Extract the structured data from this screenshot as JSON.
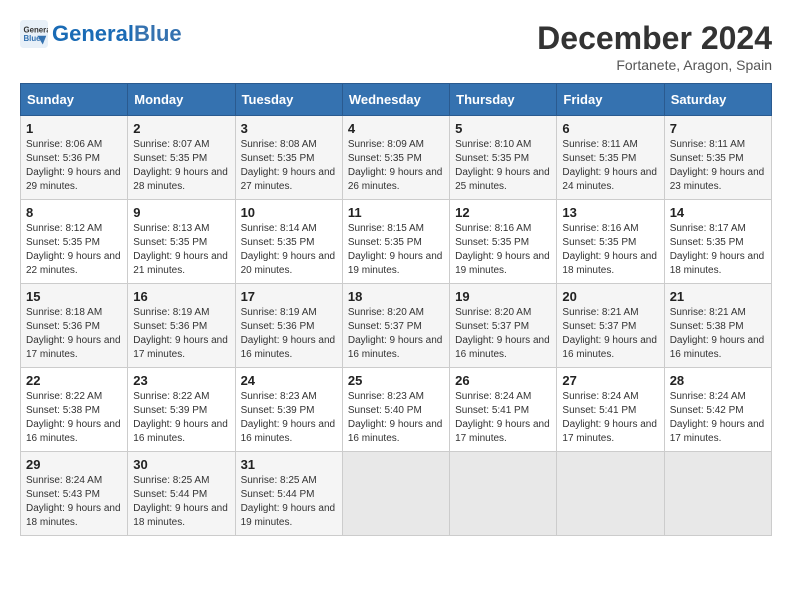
{
  "logo": {
    "text_general": "General",
    "text_blue": "Blue"
  },
  "title": "December 2024",
  "subtitle": "Fortanete, Aragon, Spain",
  "days_header": [
    "Sunday",
    "Monday",
    "Tuesday",
    "Wednesday",
    "Thursday",
    "Friday",
    "Saturday"
  ],
  "weeks": [
    [
      {
        "day": "1",
        "sunrise": "Sunrise: 8:06 AM",
        "sunset": "Sunset: 5:36 PM",
        "daylight": "Daylight: 9 hours and 29 minutes."
      },
      {
        "day": "2",
        "sunrise": "Sunrise: 8:07 AM",
        "sunset": "Sunset: 5:35 PM",
        "daylight": "Daylight: 9 hours and 28 minutes."
      },
      {
        "day": "3",
        "sunrise": "Sunrise: 8:08 AM",
        "sunset": "Sunset: 5:35 PM",
        "daylight": "Daylight: 9 hours and 27 minutes."
      },
      {
        "day": "4",
        "sunrise": "Sunrise: 8:09 AM",
        "sunset": "Sunset: 5:35 PM",
        "daylight": "Daylight: 9 hours and 26 minutes."
      },
      {
        "day": "5",
        "sunrise": "Sunrise: 8:10 AM",
        "sunset": "Sunset: 5:35 PM",
        "daylight": "Daylight: 9 hours and 25 minutes."
      },
      {
        "day": "6",
        "sunrise": "Sunrise: 8:11 AM",
        "sunset": "Sunset: 5:35 PM",
        "daylight": "Daylight: 9 hours and 24 minutes."
      },
      {
        "day": "7",
        "sunrise": "Sunrise: 8:11 AM",
        "sunset": "Sunset: 5:35 PM",
        "daylight": "Daylight: 9 hours and 23 minutes."
      }
    ],
    [
      {
        "day": "8",
        "sunrise": "Sunrise: 8:12 AM",
        "sunset": "Sunset: 5:35 PM",
        "daylight": "Daylight: 9 hours and 22 minutes."
      },
      {
        "day": "9",
        "sunrise": "Sunrise: 8:13 AM",
        "sunset": "Sunset: 5:35 PM",
        "daylight": "Daylight: 9 hours and 21 minutes."
      },
      {
        "day": "10",
        "sunrise": "Sunrise: 8:14 AM",
        "sunset": "Sunset: 5:35 PM",
        "daylight": "Daylight: 9 hours and 20 minutes."
      },
      {
        "day": "11",
        "sunrise": "Sunrise: 8:15 AM",
        "sunset": "Sunset: 5:35 PM",
        "daylight": "Daylight: 9 hours and 19 minutes."
      },
      {
        "day": "12",
        "sunrise": "Sunrise: 8:16 AM",
        "sunset": "Sunset: 5:35 PM",
        "daylight": "Daylight: 9 hours and 19 minutes."
      },
      {
        "day": "13",
        "sunrise": "Sunrise: 8:16 AM",
        "sunset": "Sunset: 5:35 PM",
        "daylight": "Daylight: 9 hours and 18 minutes."
      },
      {
        "day": "14",
        "sunrise": "Sunrise: 8:17 AM",
        "sunset": "Sunset: 5:35 PM",
        "daylight": "Daylight: 9 hours and 18 minutes."
      }
    ],
    [
      {
        "day": "15",
        "sunrise": "Sunrise: 8:18 AM",
        "sunset": "Sunset: 5:36 PM",
        "daylight": "Daylight: 9 hours and 17 minutes."
      },
      {
        "day": "16",
        "sunrise": "Sunrise: 8:19 AM",
        "sunset": "Sunset: 5:36 PM",
        "daylight": "Daylight: 9 hours and 17 minutes."
      },
      {
        "day": "17",
        "sunrise": "Sunrise: 8:19 AM",
        "sunset": "Sunset: 5:36 PM",
        "daylight": "Daylight: 9 hours and 16 minutes."
      },
      {
        "day": "18",
        "sunrise": "Sunrise: 8:20 AM",
        "sunset": "Sunset: 5:37 PM",
        "daylight": "Daylight: 9 hours and 16 minutes."
      },
      {
        "day": "19",
        "sunrise": "Sunrise: 8:20 AM",
        "sunset": "Sunset: 5:37 PM",
        "daylight": "Daylight: 9 hours and 16 minutes."
      },
      {
        "day": "20",
        "sunrise": "Sunrise: 8:21 AM",
        "sunset": "Sunset: 5:37 PM",
        "daylight": "Daylight: 9 hours and 16 minutes."
      },
      {
        "day": "21",
        "sunrise": "Sunrise: 8:21 AM",
        "sunset": "Sunset: 5:38 PM",
        "daylight": "Daylight: 9 hours and 16 minutes."
      }
    ],
    [
      {
        "day": "22",
        "sunrise": "Sunrise: 8:22 AM",
        "sunset": "Sunset: 5:38 PM",
        "daylight": "Daylight: 9 hours and 16 minutes."
      },
      {
        "day": "23",
        "sunrise": "Sunrise: 8:22 AM",
        "sunset": "Sunset: 5:39 PM",
        "daylight": "Daylight: 9 hours and 16 minutes."
      },
      {
        "day": "24",
        "sunrise": "Sunrise: 8:23 AM",
        "sunset": "Sunset: 5:39 PM",
        "daylight": "Daylight: 9 hours and 16 minutes."
      },
      {
        "day": "25",
        "sunrise": "Sunrise: 8:23 AM",
        "sunset": "Sunset: 5:40 PM",
        "daylight": "Daylight: 9 hours and 16 minutes."
      },
      {
        "day": "26",
        "sunrise": "Sunrise: 8:24 AM",
        "sunset": "Sunset: 5:41 PM",
        "daylight": "Daylight: 9 hours and 17 minutes."
      },
      {
        "day": "27",
        "sunrise": "Sunrise: 8:24 AM",
        "sunset": "Sunset: 5:41 PM",
        "daylight": "Daylight: 9 hours and 17 minutes."
      },
      {
        "day": "28",
        "sunrise": "Sunrise: 8:24 AM",
        "sunset": "Sunset: 5:42 PM",
        "daylight": "Daylight: 9 hours and 17 minutes."
      }
    ],
    [
      {
        "day": "29",
        "sunrise": "Sunrise: 8:24 AM",
        "sunset": "Sunset: 5:43 PM",
        "daylight": "Daylight: 9 hours and 18 minutes."
      },
      {
        "day": "30",
        "sunrise": "Sunrise: 8:25 AM",
        "sunset": "Sunset: 5:44 PM",
        "daylight": "Daylight: 9 hours and 18 minutes."
      },
      {
        "day": "31",
        "sunrise": "Sunrise: 8:25 AM",
        "sunset": "Sunset: 5:44 PM",
        "daylight": "Daylight: 9 hours and 19 minutes."
      },
      null,
      null,
      null,
      null
    ]
  ]
}
